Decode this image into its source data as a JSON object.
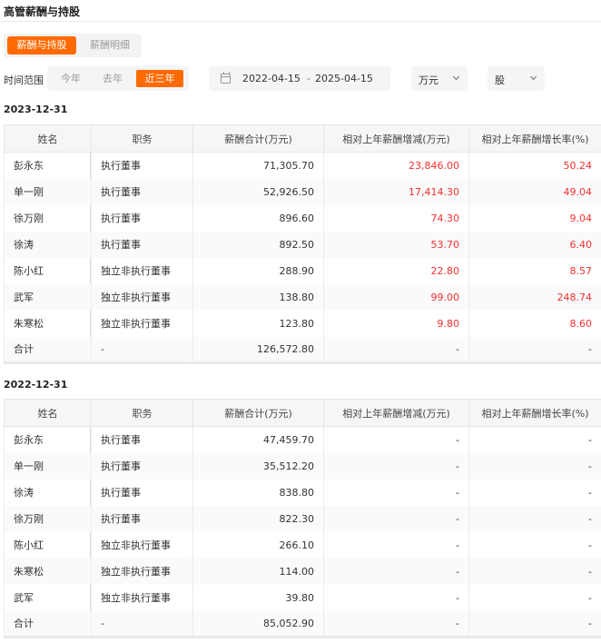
{
  "page": {
    "title": "高管薪酬与持股"
  },
  "tabs": [
    {
      "label": "薪酬与持股",
      "active": true
    },
    {
      "label": "薪酬明细",
      "active": false
    }
  ],
  "filters": {
    "label": "时间范围",
    "range_options": [
      "今年",
      "去年",
      "近三年"
    ],
    "selected_range": "近三年",
    "date_start": "2022-04-15",
    "date_sep": "-",
    "date_end": "2025-04-15",
    "unit": "万元",
    "share_unit": "股"
  },
  "colors": {
    "accent": "#ff6a00",
    "increase": "#f23030"
  },
  "columns": [
    "姓名",
    "职务",
    "薪酬合计(万元)",
    "相对上年薪酬增减(万元)",
    "相对上年薪酬增长率(%)"
  ],
  "sections": [
    {
      "date": "2023-12-31",
      "rows": [
        {
          "name": "彭永东",
          "role": "执行董事",
          "total": "71,305.70",
          "change": "23,846.00",
          "rate": "50.24"
        },
        {
          "name": "单一刚",
          "role": "执行董事",
          "total": "52,926.50",
          "change": "17,414.30",
          "rate": "49.04"
        },
        {
          "name": "徐万刚",
          "role": "执行董事",
          "total": "896.60",
          "change": "74.30",
          "rate": "9.04"
        },
        {
          "name": "徐涛",
          "role": "执行董事",
          "total": "892.50",
          "change": "53.70",
          "rate": "6.40"
        },
        {
          "name": "陈小红",
          "role": "独立非执行董事",
          "total": "288.90",
          "change": "22.80",
          "rate": "8.57"
        },
        {
          "name": "武军",
          "role": "独立非执行董事",
          "total": "138.80",
          "change": "99.00",
          "rate": "248.74"
        },
        {
          "name": "朱寒松",
          "role": "独立非执行董事",
          "total": "123.80",
          "change": "9.80",
          "rate": "8.60"
        },
        {
          "name": "合计",
          "role": "-",
          "total": "126,572.80",
          "change": "-",
          "rate": "-"
        }
      ]
    },
    {
      "date": "2022-12-31",
      "rows": [
        {
          "name": "彭永东",
          "role": "执行董事",
          "total": "47,459.70",
          "change": "-",
          "rate": "-"
        },
        {
          "name": "单一刚",
          "role": "执行董事",
          "total": "35,512.20",
          "change": "-",
          "rate": "-"
        },
        {
          "name": "徐涛",
          "role": "执行董事",
          "total": "838.80",
          "change": "-",
          "rate": "-"
        },
        {
          "name": "徐万刚",
          "role": "执行董事",
          "total": "822.30",
          "change": "-",
          "rate": "-"
        },
        {
          "name": "陈小红",
          "role": "独立非执行董事",
          "total": "266.10",
          "change": "-",
          "rate": "-"
        },
        {
          "name": "朱寒松",
          "role": "独立非执行董事",
          "total": "114.00",
          "change": "-",
          "rate": "-"
        },
        {
          "name": "武军",
          "role": "独立非执行董事",
          "total": "39.80",
          "change": "-",
          "rate": "-"
        },
        {
          "name": "合计",
          "role": "-",
          "total": "85,052.90",
          "change": "-",
          "rate": "-"
        }
      ]
    }
  ]
}
